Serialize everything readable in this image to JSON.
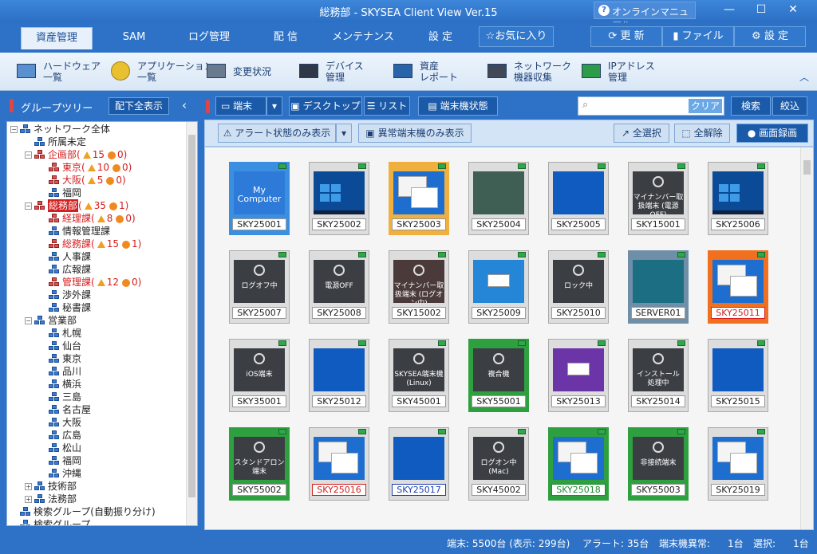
{
  "window": {
    "title": "総務部 - SKYSEA Client View Ver.15",
    "help": "オンラインマニュアル"
  },
  "menu": {
    "tabs": [
      "資産管理",
      "SAM",
      "ログ管理",
      "配 信",
      "メンテナンス",
      "設 定"
    ],
    "fav": "お気に入り",
    "refresh": "更 新",
    "file": "ファイル",
    "settings": "設 定"
  },
  "ribbon": [
    {
      "l1": "ハードウェア",
      "l2": "一覧"
    },
    {
      "l1": "アプリケーション",
      "l2": "一覧"
    },
    {
      "l1": "変更状況",
      "l2": ""
    },
    {
      "l1": "デバイス",
      "l2": "管理"
    },
    {
      "l1": "資産",
      "l2": "レポート"
    },
    {
      "l1": "ネットワーク",
      "l2": "機器収集"
    },
    {
      "l1": "IPアドレス",
      "l2": "管理"
    }
  ],
  "left": {
    "header": "グループツリー",
    "expand_all": "配下全表示"
  },
  "tree": [
    {
      "label": "ネットワーク全体",
      "indent": 0,
      "exp": "−"
    },
    {
      "label": "所属未定",
      "indent": 1
    },
    {
      "label": "企画部",
      "indent": 1,
      "exp": "−",
      "red": true,
      "warn": "15",
      "err": "0"
    },
    {
      "label": "東京",
      "indent": 2,
      "red": true,
      "warn": "10",
      "err": "0"
    },
    {
      "label": "大阪",
      "indent": 2,
      "red": true,
      "warn": "5",
      "err": "0"
    },
    {
      "label": "福岡",
      "indent": 2
    },
    {
      "label": "総務部",
      "indent": 1,
      "exp": "−",
      "red": true,
      "hi": true,
      "warn": "35",
      "err": "1"
    },
    {
      "label": "経理課",
      "indent": 2,
      "red": true,
      "warn": "8",
      "err": "0"
    },
    {
      "label": "情報管理課",
      "indent": 2
    },
    {
      "label": "総務課",
      "indent": 2,
      "red": true,
      "warn": "15",
      "err": "1"
    },
    {
      "label": "人事課",
      "indent": 2
    },
    {
      "label": "広報課",
      "indent": 2
    },
    {
      "label": "管理課",
      "indent": 2,
      "red": true,
      "warn": "12",
      "err": "0"
    },
    {
      "label": "渉外課",
      "indent": 2
    },
    {
      "label": "秘書課",
      "indent": 2
    },
    {
      "label": "営業部",
      "indent": 1,
      "exp": "−"
    },
    {
      "label": "札幌",
      "indent": 2
    },
    {
      "label": "仙台",
      "indent": 2
    },
    {
      "label": "東京",
      "indent": 2
    },
    {
      "label": "品川",
      "indent": 2
    },
    {
      "label": "横浜",
      "indent": 2
    },
    {
      "label": "三島",
      "indent": 2
    },
    {
      "label": "名古屋",
      "indent": 2
    },
    {
      "label": "大阪",
      "indent": 2
    },
    {
      "label": "広島",
      "indent": 2
    },
    {
      "label": "松山",
      "indent": 2
    },
    {
      "label": "福岡",
      "indent": 2
    },
    {
      "label": "沖縄",
      "indent": 2
    },
    {
      "label": "技術部",
      "indent": 1,
      "exp": "+"
    },
    {
      "label": "法務部",
      "indent": 1,
      "exp": "+"
    },
    {
      "label": "検索グループ(自動振り分け)",
      "indent": 0,
      "search": true
    },
    {
      "label": "検索グループ",
      "indent": 0,
      "search": true
    }
  ],
  "toolbar": {
    "terminal": "端末",
    "desktop": "デスクトップ",
    "list": "リスト",
    "status": "端末機状態",
    "clear": "クリア",
    "search": "検索",
    "filter": "絞込",
    "alert_only": "アラート状態のみ表示",
    "abnormal_only": "異常端末機のみ表示",
    "select_all": "全選択",
    "deselect_all": "全解除",
    "record": "画面録画"
  },
  "tiles": [
    {
      "name": "SKY25001",
      "kind": "mycomp",
      "cap": "My Computer",
      "frame": "#3b8fe0"
    },
    {
      "name": "SKY25002",
      "kind": "win10"
    },
    {
      "name": "SKY25003",
      "kind": "winwhite",
      "frame": "#f0b040"
    },
    {
      "name": "SKY25004",
      "kind": "green"
    },
    {
      "name": "SKY25005",
      "kind": "blue"
    },
    {
      "name": "SKY15001",
      "kind": "dark",
      "cap": "マイナンバー取扱端末 (電源OFF)"
    },
    {
      "name": "SKY25006",
      "kind": "win10"
    },
    {
      "name": "SKY25007",
      "kind": "dark",
      "cap": "ログオフ中"
    },
    {
      "name": "SKY25008",
      "kind": "dark",
      "cap": "電源OFF"
    },
    {
      "name": "SKY15002",
      "kind": "dark2",
      "cap": "マイナンバー取扱端末 (ログオン中)"
    },
    {
      "name": "SKY25009",
      "kind": "lightblue"
    },
    {
      "name": "SKY25010",
      "kind": "dark",
      "cap": "ロック中"
    },
    {
      "name": "SERVER01",
      "kind": "teal",
      "frame": "#6f8fa8"
    },
    {
      "name": "SKY25011",
      "kind": "winwhite",
      "frame": "#f07020",
      "redname": true
    },
    {
      "name": "SKY35001",
      "kind": "dark",
      "cap": "iOS端末"
    },
    {
      "name": "SKY25012",
      "kind": "blue"
    },
    {
      "name": "SKY45001",
      "kind": "dark",
      "cap": "SKYSEA端末機 (Linux)"
    },
    {
      "name": "SKY55001",
      "kind": "dark",
      "cap": "複合機",
      "frame": "#2fa040"
    },
    {
      "name": "SKY25013",
      "kind": "purple"
    },
    {
      "name": "SKY25014",
      "kind": "dark",
      "cap": "インストール 処理中"
    },
    {
      "name": "SKY25015",
      "kind": "blue"
    },
    {
      "name": "SKY55002",
      "kind": "dark",
      "cap": "スタンドアロン 端末",
      "frame": "#2fa040"
    },
    {
      "name": "SKY25016",
      "kind": "winwhite",
      "redname": true
    },
    {
      "name": "SKY25017",
      "kind": "blue",
      "bluename": true
    },
    {
      "name": "SKY45002",
      "kind": "dark",
      "cap": "ログオン中 (Mac)"
    },
    {
      "name": "SKY25018",
      "kind": "winwhite",
      "frame": "#2fa040",
      "greenname": true
    },
    {
      "name": "SKY55003",
      "kind": "dark",
      "cap": "非接続端末",
      "frame": "#2fa040"
    },
    {
      "name": "SKY25019",
      "kind": "winwhite"
    }
  ],
  "statusbar": {
    "terminals": "端末: 5500台 (表示: 299台)",
    "alert_label": "アラート:",
    "alert": "35台",
    "abn_label": "端末機異常:",
    "abn": "1台",
    "sel_label": "選択:",
    "sel": "1台"
  }
}
